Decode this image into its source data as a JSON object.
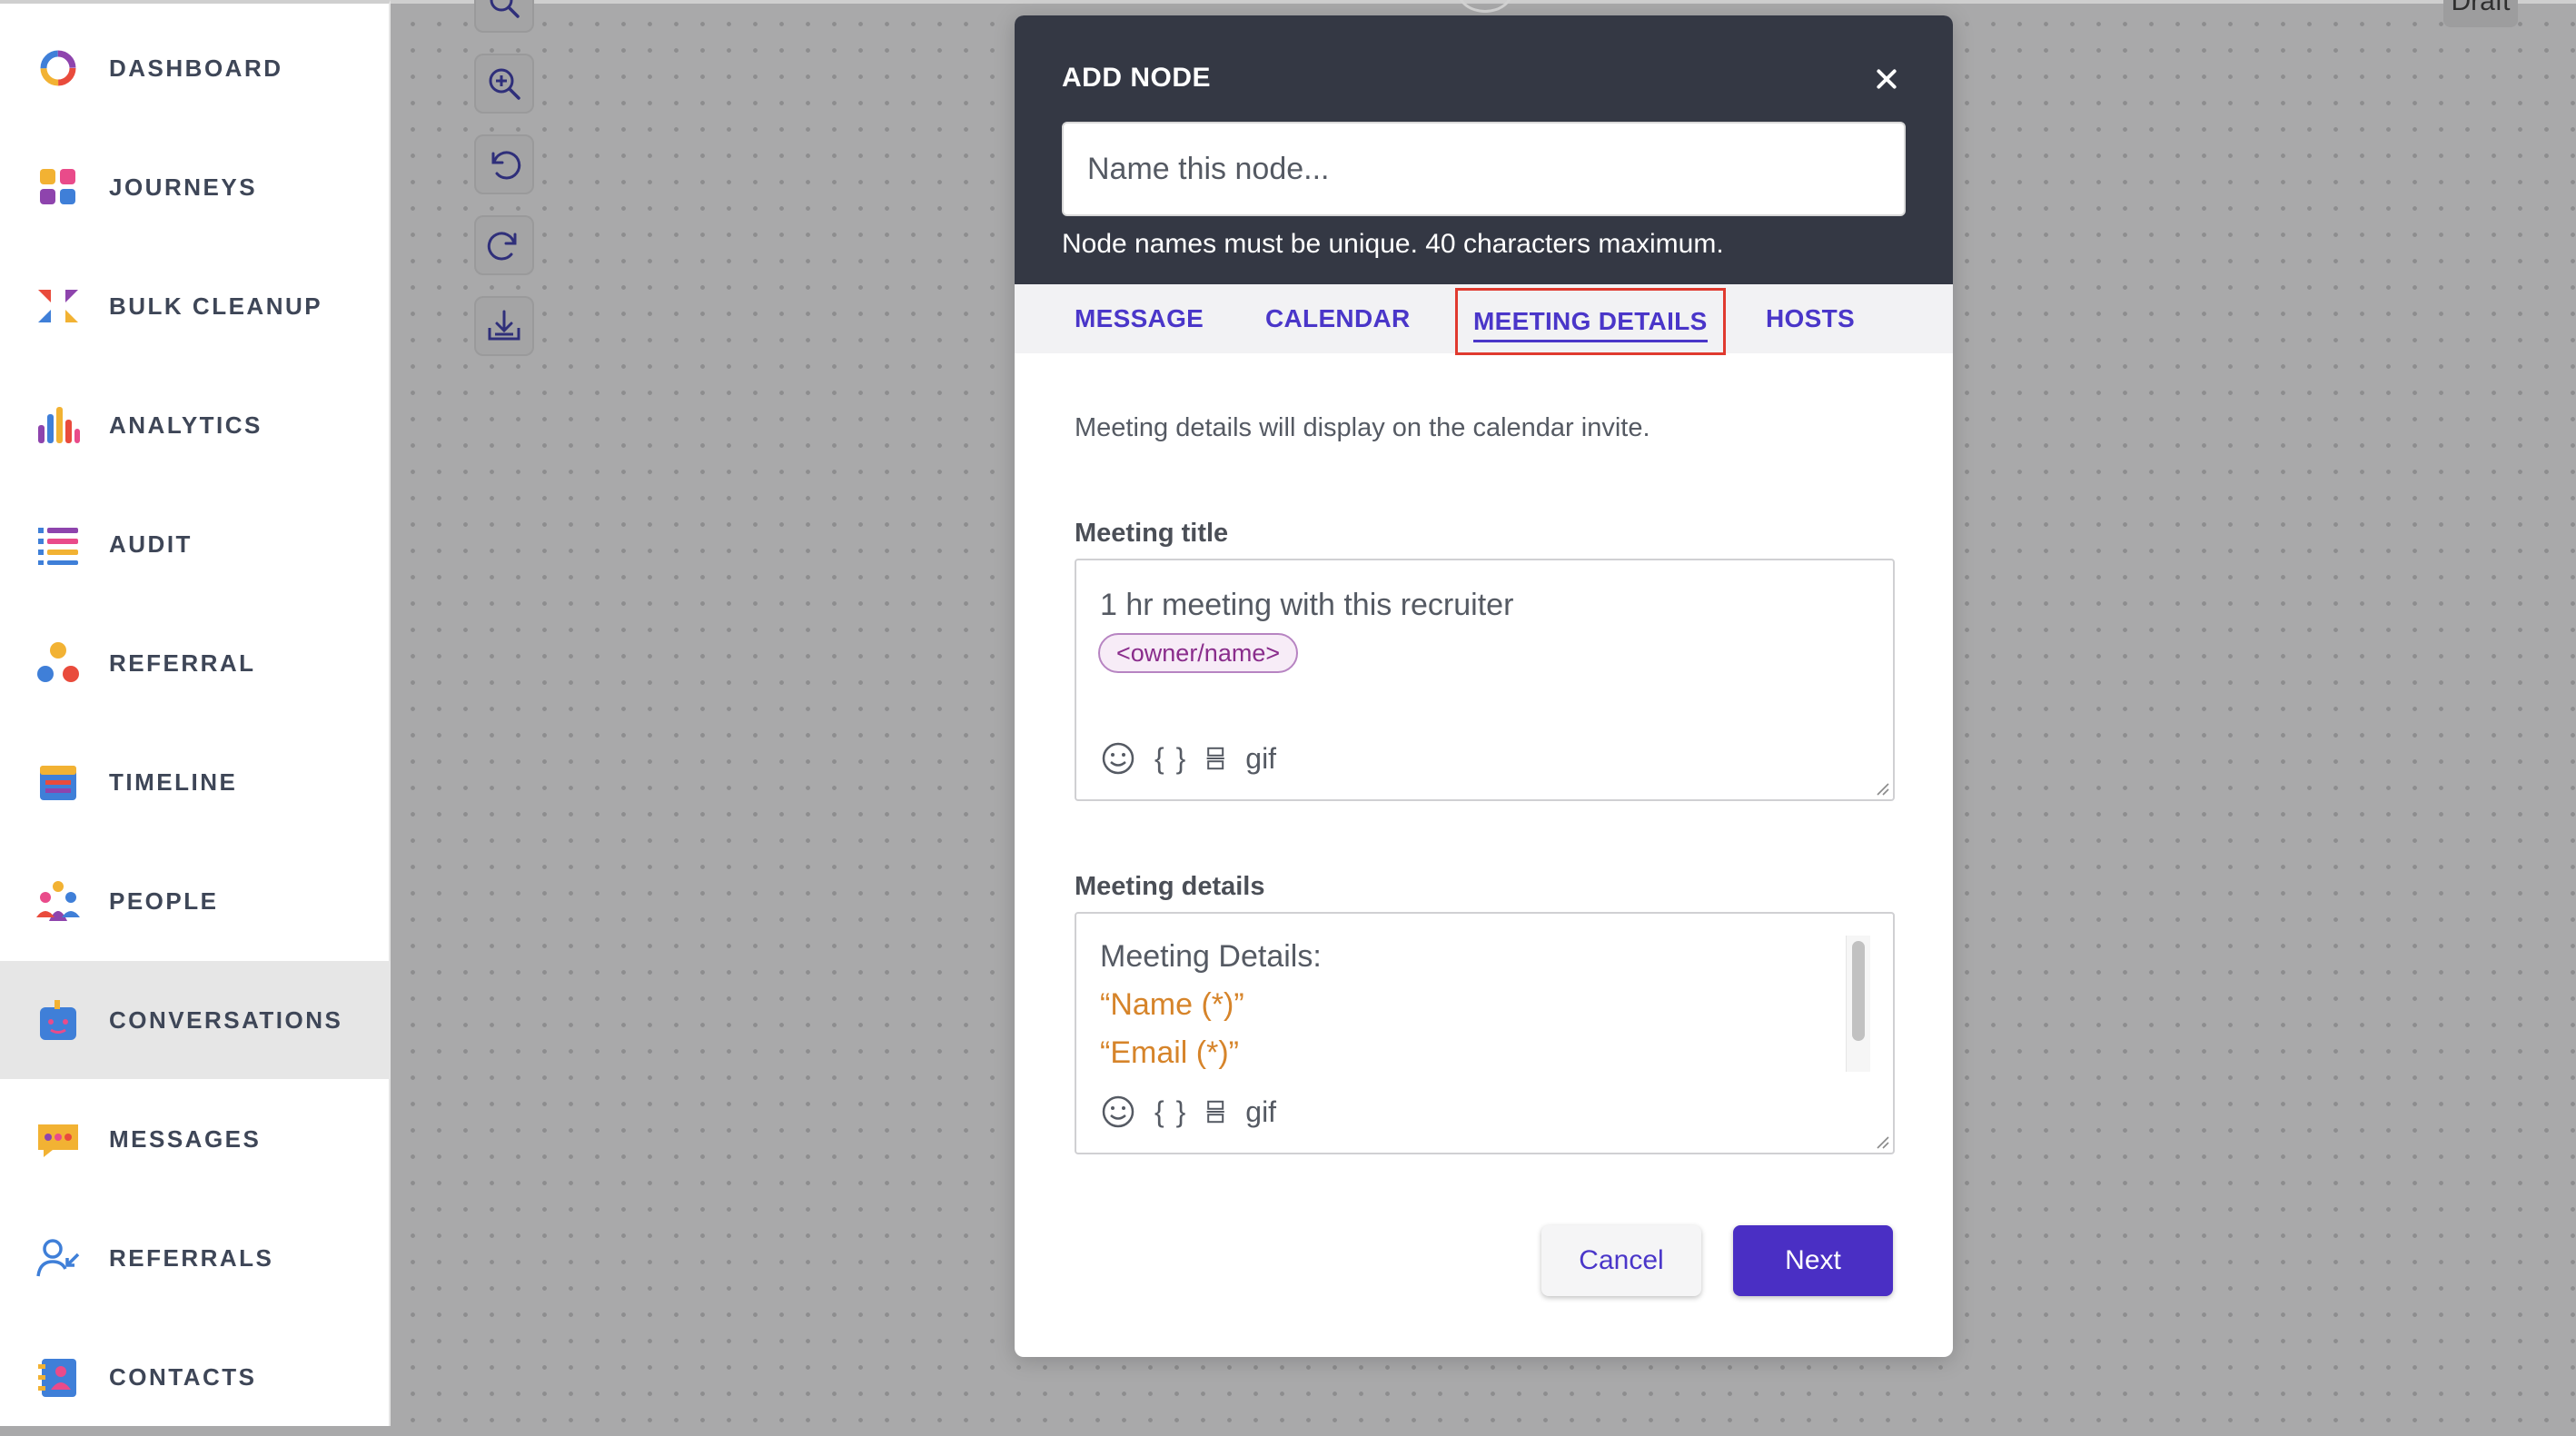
{
  "sidebar": {
    "items": [
      {
        "label": "DASHBOARD",
        "icon": "dashboard-ring-icon"
      },
      {
        "label": "JOURNEYS",
        "icon": "journeys-grid-icon"
      },
      {
        "label": "BULK CLEANUP",
        "icon": "bulk-cleanup-arrows-icon"
      },
      {
        "label": "ANALYTICS",
        "icon": "analytics-bars-icon"
      },
      {
        "label": "AUDIT",
        "icon": "audit-list-icon"
      },
      {
        "label": "REFERRAL",
        "icon": "referral-nodes-icon"
      },
      {
        "label": "TIMELINE",
        "icon": "timeline-calendar-icon"
      },
      {
        "label": "PEOPLE",
        "icon": "people-group-icon"
      },
      {
        "label": "CONVERSATIONS",
        "icon": "conversations-bot-icon"
      },
      {
        "label": "MESSAGES",
        "icon": "messages-bubble-icon"
      },
      {
        "label": "REFERRALS",
        "icon": "referrals-person-icon"
      },
      {
        "label": "CONTACTS",
        "icon": "contacts-book-icon"
      }
    ],
    "active": "CONVERSATIONS"
  },
  "canvas": {
    "draft_label": "Draft",
    "tools": [
      "search-icon",
      "zoom-in-icon",
      "undo-icon",
      "redo-icon",
      "download-icon"
    ]
  },
  "modal": {
    "title": "ADD NODE",
    "name_placeholder": "Name this node...",
    "name_hint": "Node names must be unique. 40 characters maximum.",
    "tabs": [
      "MESSAGE",
      "CALENDAR",
      "MEETING DETAILS",
      "HOSTS"
    ],
    "selected_tab": "MEETING DETAILS",
    "description": "Meeting details will display on the calendar invite.",
    "meeting_title": {
      "label": "Meeting title",
      "text": "1 hr meeting with this recruiter",
      "token": "<owner/name>"
    },
    "meeting_details": {
      "label": "Meeting details",
      "line1": "Meeting Details:",
      "line2": "“Name (*)”",
      "line3": "“Email (*)”"
    },
    "toolbar": {
      "braces": "{ }",
      "gif": "gif"
    },
    "cancel_label": "Cancel",
    "next_label": "Next"
  },
  "colors": {
    "accent": "#4a2fc4",
    "header_bg": "#343844",
    "highlight_box": "#e03a2f",
    "token_text": "#8a2d8c",
    "placeholder_orange": "#d6842a"
  }
}
